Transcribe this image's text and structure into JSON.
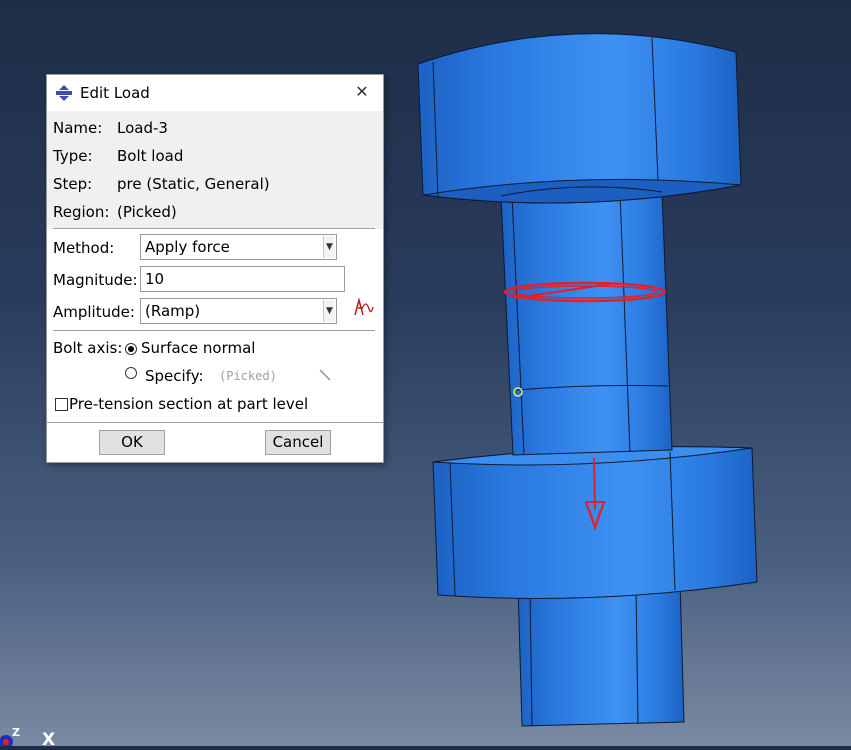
{
  "dialog": {
    "title": "Edit Load",
    "close_symbol": "✕",
    "info": [
      {
        "key": "Name:",
        "value": "Load-3"
      },
      {
        "key": "Type:",
        "value": "Bolt load"
      },
      {
        "key": "Step:",
        "value": "pre (Static, General)"
      },
      {
        "key": "Region:",
        "value": "(Picked)"
      }
    ],
    "method": {
      "label": "Method:",
      "value": "Apply force"
    },
    "magnitude": {
      "label": "Magnitude:",
      "value": "10"
    },
    "amplitude": {
      "label": "Amplitude:",
      "value": "(Ramp)"
    },
    "bolt_axis": {
      "label": "Bolt axis:",
      "surface_normal": "Surface normal",
      "specify": "Specify:",
      "specify_value": "(Picked)",
      "selected": "Surface normal"
    },
    "pretension": {
      "label": "Pre-tension section at part level",
      "checked": false
    },
    "ok_label": "OK",
    "cancel_label": "Cancel"
  },
  "triad": {
    "x_label": "X",
    "z_label": "Z"
  },
  "colors": {
    "part": "#2a7ae0",
    "load": "#e0202a",
    "background_top": "#1e2d47",
    "background_bottom": "#7b8aa3"
  }
}
